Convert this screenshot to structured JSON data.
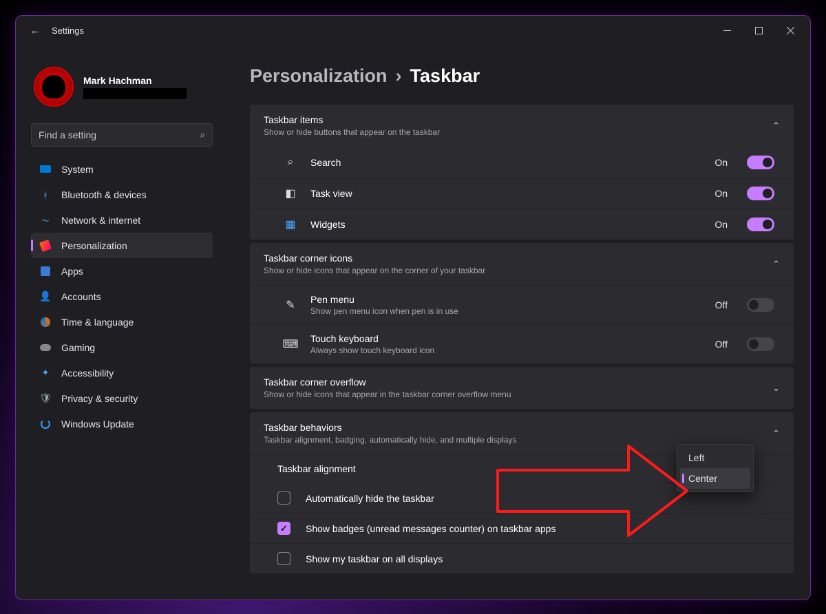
{
  "titlebar": {
    "app": "Settings"
  },
  "profile": {
    "name": "Mark Hachman"
  },
  "search": {
    "placeholder": "Find a setting"
  },
  "sidebar": {
    "items": [
      {
        "label": "System"
      },
      {
        "label": "Bluetooth & devices"
      },
      {
        "label": "Network & internet"
      },
      {
        "label": "Personalization"
      },
      {
        "label": "Apps"
      },
      {
        "label": "Accounts"
      },
      {
        "label": "Time & language"
      },
      {
        "label": "Gaming"
      },
      {
        "label": "Accessibility"
      },
      {
        "label": "Privacy & security"
      },
      {
        "label": "Windows Update"
      }
    ],
    "active_index": 3
  },
  "breadcrumb": {
    "parent": "Personalization",
    "sep": "›",
    "current": "Taskbar"
  },
  "sections": {
    "taskbar_items": {
      "title": "Taskbar items",
      "desc": "Show or hide buttons that appear on the taskbar",
      "expanded": true,
      "rows": [
        {
          "label": "Search",
          "state": "On",
          "on": true
        },
        {
          "label": "Task view",
          "state": "On",
          "on": true
        },
        {
          "label": "Widgets",
          "state": "On",
          "on": true
        }
      ]
    },
    "corner_icons": {
      "title": "Taskbar corner icons",
      "desc": "Show or hide icons that appear on the corner of your taskbar",
      "expanded": true,
      "rows": [
        {
          "label": "Pen menu",
          "desc": "Show pen menu icon when pen is in use",
          "state": "Off",
          "on": false
        },
        {
          "label": "Touch keyboard",
          "desc": "Always show touch keyboard icon",
          "state": "Off",
          "on": false
        }
      ]
    },
    "corner_overflow": {
      "title": "Taskbar corner overflow",
      "desc": "Show or hide icons that appear in the taskbar corner overflow menu",
      "expanded": false
    },
    "behaviors": {
      "title": "Taskbar behaviors",
      "desc": "Taskbar alignment, badging, automatically hide, and multiple displays",
      "expanded": true,
      "alignment_label": "Taskbar alignment",
      "alignment_options": [
        "Left",
        "Center"
      ],
      "alignment_selected": "Center",
      "checks": [
        {
          "label": "Automatically hide the taskbar",
          "checked": false
        },
        {
          "label": "Show badges (unread messages counter) on taskbar apps",
          "checked": true
        },
        {
          "label": "Show my taskbar on all displays",
          "checked": false
        }
      ]
    }
  }
}
